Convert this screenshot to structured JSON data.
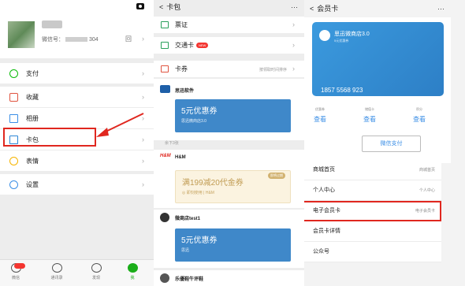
{
  "me": {
    "wx_label": "微信号：",
    "wx_tail": "304",
    "qr_glyph": "回",
    "menu": [
      {
        "label": "支付"
      },
      {
        "label": "收藏"
      },
      {
        "label": "相册"
      },
      {
        "label": "卡包"
      },
      {
        "label": "表情"
      },
      {
        "label": "设置"
      }
    ],
    "tabs": [
      "微信",
      "通讯录",
      "发现",
      "我"
    ]
  },
  "wallet": {
    "title": "卡包",
    "back": "<",
    "more": "···",
    "rows": [
      {
        "label": "票证"
      },
      {
        "label": "交通卡",
        "badge": "NEW"
      },
      {
        "label": "卡券",
        "hint": "按领取时间排序"
      }
    ],
    "merchants": [
      {
        "name": "思迅软件",
        "coupon_title": "5元优惠券",
        "coupon_sub": "思迅微商店3.0",
        "more": "余下3张"
      },
      {
        "name": "H&M",
        "logo": "H&M",
        "coupon_title": "满199减20代金券",
        "coupon_sub": "◎ 即刻使用 | H&M",
        "tag": "即将过期"
      },
      {
        "name": "微商店test1",
        "coupon_title": "5元优惠券",
        "coupon_sub": "思迅"
      },
      {
        "name": "乐優鞋牛评鞋"
      }
    ]
  },
  "member": {
    "title": "会员卡",
    "back": "<",
    "more": "···",
    "card": {
      "name": "思迅微商店3.0",
      "sub": "5元优惠券",
      "number": "1857 5568 923"
    },
    "stats": [
      {
        "label": "优惠券",
        "value": "查看"
      },
      {
        "label": "储值卡",
        "value": "查看"
      },
      {
        "label": "积分",
        "value": "查看"
      }
    ],
    "pay_button": "微信支付",
    "links": [
      {
        "label": "商城首页",
        "value": "商城首页"
      },
      {
        "label": "个人中心",
        "value": "个人中心"
      },
      {
        "label": "电子会员卡",
        "value": "电子会员卡"
      },
      {
        "label": "会员卡详情",
        "value": ""
      },
      {
        "label": "公众号",
        "value": ""
      }
    ]
  },
  "colors": {
    "highlight": "#e0271f",
    "wechat_green": "#1aad19",
    "card_blue": "#3b9ade",
    "coupon_blue": "#3f88c9",
    "coupon_gold": "#fbf3e0"
  }
}
